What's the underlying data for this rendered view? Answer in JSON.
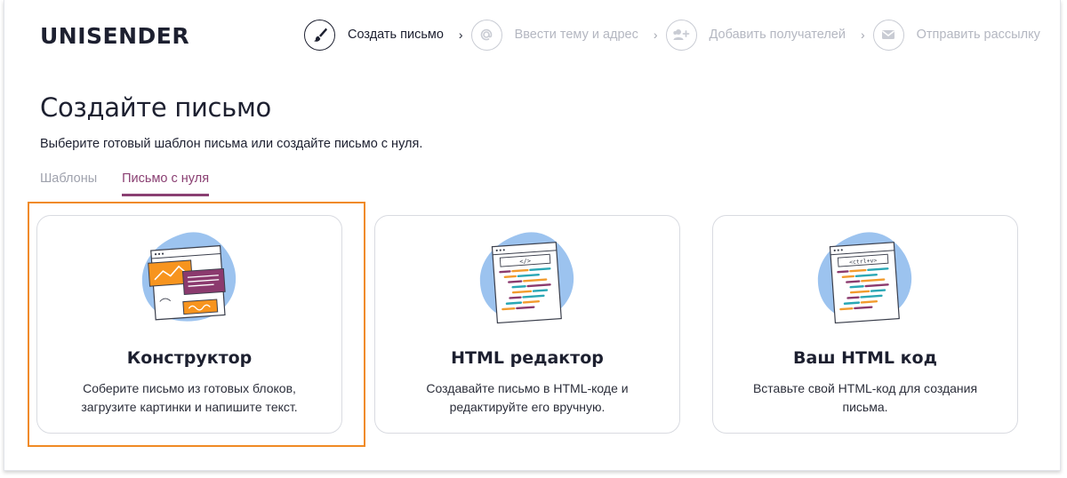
{
  "brand": {
    "logo": "UNISENDER"
  },
  "stepper": {
    "steps": [
      {
        "label": "Создать письмо",
        "icon": "brush-icon",
        "active": true
      },
      {
        "label": "Ввести тему и адрес",
        "icon": "at-sign-icon",
        "active": false
      },
      {
        "label": "Добавить получателей",
        "icon": "add-users-icon",
        "active": false
      },
      {
        "label": "Отправить рассылку",
        "icon": "envelope-icon",
        "active": false
      }
    ],
    "separator": "›"
  },
  "page": {
    "title": "Создайте письмо",
    "subtitle": "Выберите готовый шаблон письма или создайте письмо с нуля."
  },
  "tabs": [
    {
      "label": "Шаблоны",
      "active": false
    },
    {
      "label": "Письмо с нуля",
      "active": true
    }
  ],
  "cards": [
    {
      "title": "Конструктор",
      "desc_line1": "Соберите письмо из готовых блоков,",
      "desc_line2": "загрузите картинки и напишите текст.",
      "icon": "constructor-illustration",
      "selected": true
    },
    {
      "title": "HTML редактор",
      "desc_line1": "Создавайте письмо в HTML-коде и",
      "desc_line2": "редактируйте его вручную.",
      "icon": "html-editor-illustration",
      "code_tag": "</>"
    },
    {
      "title": "Ваш HTML код",
      "desc_line1": "Вставьте свой HTML-код для создания",
      "desc_line2": "письма.",
      "icon": "paste-html-illustration",
      "code_tag": "<ctrl+v>"
    }
  ],
  "colors": {
    "accent": "#8a3f72",
    "highlight": "#f08a24",
    "blob": "#9cc3ef",
    "orange": "#f7941e",
    "purple": "#8b3a6e",
    "teal": "#2aa7b5",
    "code_orange": "#f29b2d"
  }
}
